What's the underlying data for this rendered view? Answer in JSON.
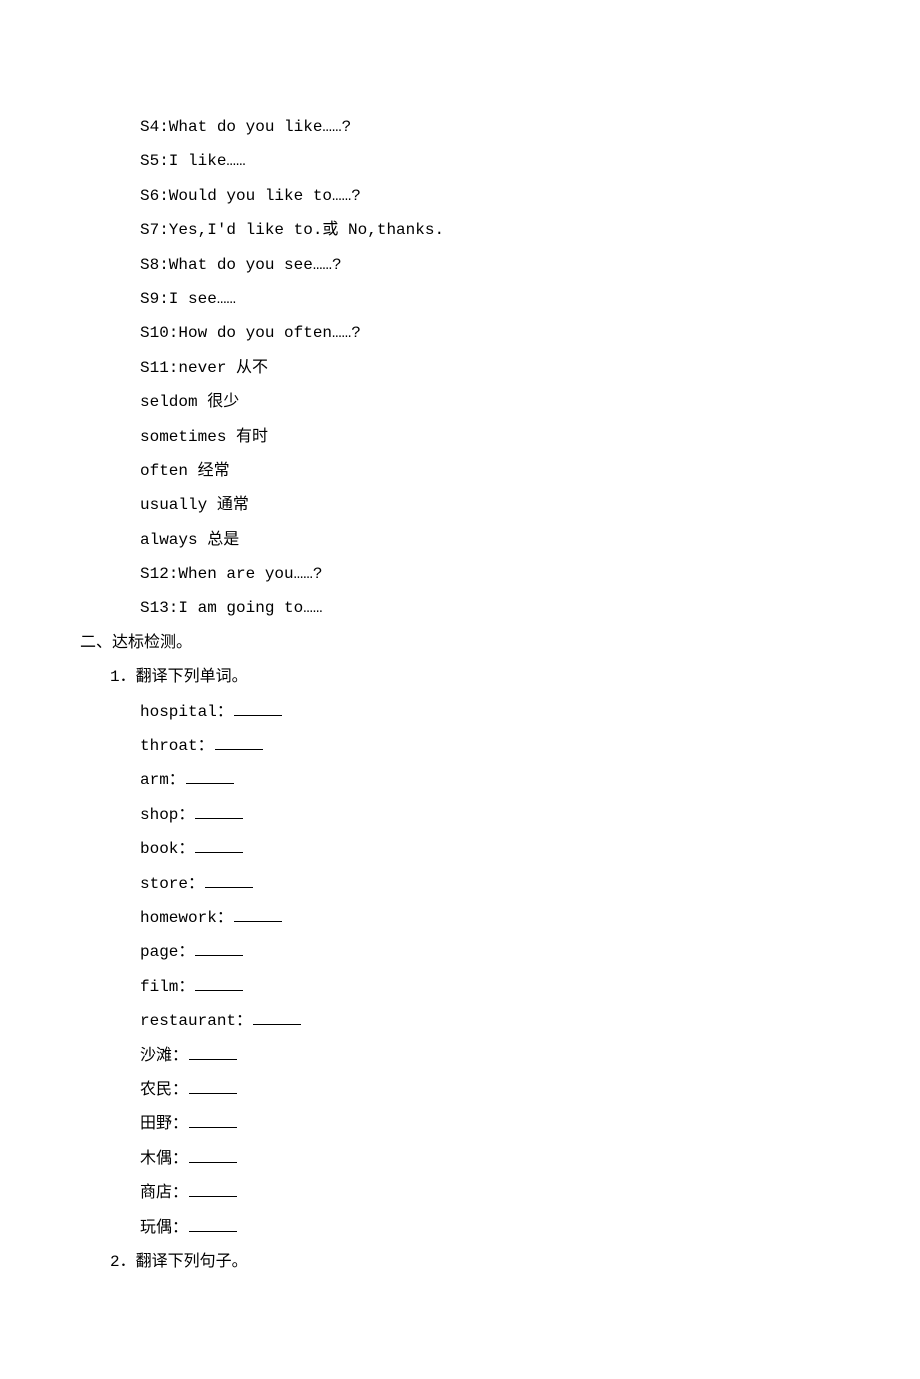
{
  "dialogue": {
    "s4": "S4:What do you like……?",
    "s5": "S5:I like……",
    "s6": "S6:Would you like to……?",
    "s7": "S7:Yes,I'd like to.或 No,thanks.",
    "s8": "S8:What do you see……?",
    "s9": "S9:I see……",
    "s10": "S10:How do you often……?",
    "s11": "S11:never 从不",
    "l12": "seldom 很少",
    "l13": "sometimes 有时",
    "l14": "often 经常",
    "l15": "usually 通常",
    "l16": "always 总是",
    "s12": "S12:When are you……?",
    "s13": "S13:I am going to……"
  },
  "section2": {
    "heading": "二、达标检测。",
    "q1": {
      "title": "1．翻译下列单词。",
      "items": [
        "hospital：",
        "throat：",
        "arm：",
        "shop：",
        "book：",
        "store：",
        "homework：",
        "page：",
        "film：",
        "restaurant：",
        "沙滩：",
        "农民：",
        "田野：",
        "木偶：",
        "商店：",
        "玩偶："
      ]
    },
    "q2": {
      "title": "2．翻译下列句子。"
    }
  }
}
